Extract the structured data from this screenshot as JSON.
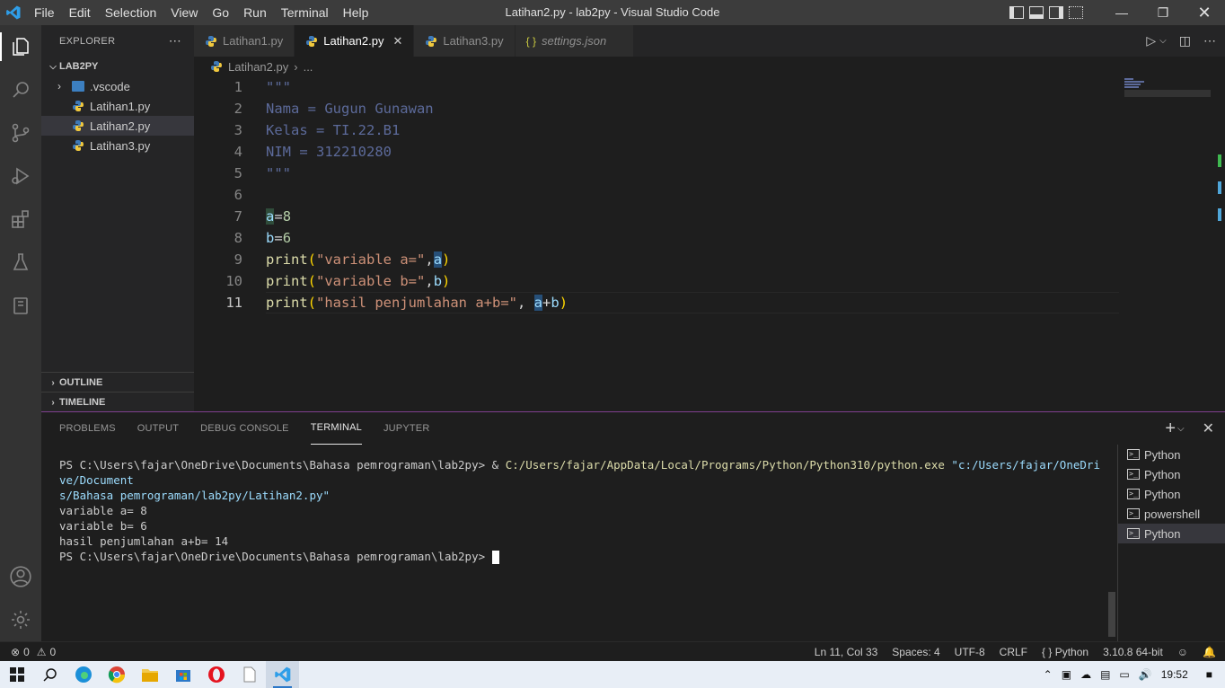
{
  "window": {
    "title": "Latihan2.py - lab2py - Visual Studio Code"
  },
  "menu": [
    "File",
    "Edit",
    "Selection",
    "View",
    "Go",
    "Run",
    "Terminal",
    "Help"
  ],
  "sidebar": {
    "title": "EXPLORER",
    "project": "LAB2PY",
    "items": [
      {
        "label": ".vscode",
        "type": "folder"
      },
      {
        "label": "Latihan1.py",
        "type": "py"
      },
      {
        "label": "Latihan2.py",
        "type": "py",
        "selected": true
      },
      {
        "label": "Latihan3.py",
        "type": "py"
      }
    ],
    "outline": "OUTLINE",
    "timeline": "TIMELINE"
  },
  "tabs": [
    {
      "label": "Latihan1.py",
      "type": "py"
    },
    {
      "label": "Latihan2.py",
      "type": "py",
      "active": true
    },
    {
      "label": "Latihan3.py",
      "type": "py"
    },
    {
      "label": "settings.json",
      "type": "json"
    }
  ],
  "breadcrumb": {
    "file": "Latihan2.py",
    "more": "..."
  },
  "code": {
    "line_numbers": [
      "1",
      "2",
      "3",
      "4",
      "5",
      "6",
      "7",
      "8",
      "9",
      "10",
      "11"
    ],
    "l1": "\"\"\"",
    "l2": "Nama = Gugun Gunawan",
    "l3": "Kelas = TI.22.B1",
    "l4": "NIM = 312210280",
    "l5": "\"\"\"",
    "l7a": "a",
    "l7b": "=",
    "l7c": "8",
    "l8a": "b",
    "l8b": "=",
    "l8c": "6",
    "l9fn": "print",
    "l9p": "(",
    "l9s": "\"variable a=\"",
    "l9c": ",",
    "l9v": "a",
    "l9e": ")",
    "l10fn": "print",
    "l10p": "(",
    "l10s": "\"variable b=\"",
    "l10c": ",",
    "l10v": "b",
    "l10e": ")",
    "l11fn": "print",
    "l11p": "(",
    "l11s": "\"hasil penjumlahan a+b=\"",
    "l11c": ", ",
    "l11v1": "a",
    "l11o": "+",
    "l11v2": "b",
    "l11e": ")"
  },
  "panel": {
    "tabs": [
      "PROBLEMS",
      "OUTPUT",
      "DEBUG CONSOLE",
      "TERMINAL",
      "JUPYTER"
    ],
    "active_tab": "TERMINAL",
    "terminal": {
      "prompt": "PS C:\\Users\\fajar\\OneDrive\\Documents\\Bahasa pemrograman\\lab2py>",
      "cmd_amp": " & ",
      "cmd_exe": "C:/Users/fajar/AppData/Local/Programs/Python/Python310/python.exe",
      "cmd_arg1": " \"c:/Users/fajar/OneDrive/Document",
      "cmd_arg2": "s/Bahasa pemrograman/lab2py/Latihan2.py\"",
      "out1": "variable a= 8",
      "out2": "variable b= 6",
      "out3": "hasil penjumlahan a+b= 14",
      "prompt2": "PS C:\\Users\\fajar\\OneDrive\\Documents\\Bahasa pemrograman\\lab2py>"
    },
    "terminals": [
      "Python",
      "Python",
      "Python",
      "powershell",
      "Python"
    ]
  },
  "status": {
    "errors": "0",
    "warnings": "0",
    "position": "Ln 11, Col 33",
    "spaces": "Spaces: 4",
    "encoding": "UTF-8",
    "eol": "CRLF",
    "language": "Python",
    "interpreter": "3.10.8 64-bit"
  },
  "taskbar": {
    "time": "19:52"
  },
  "colors": {
    "accent": "#007acc",
    "panel_border": "#80408f",
    "terminal_yellow": "#dcdcaa",
    "terminal_blue": "#9cdcfe"
  }
}
